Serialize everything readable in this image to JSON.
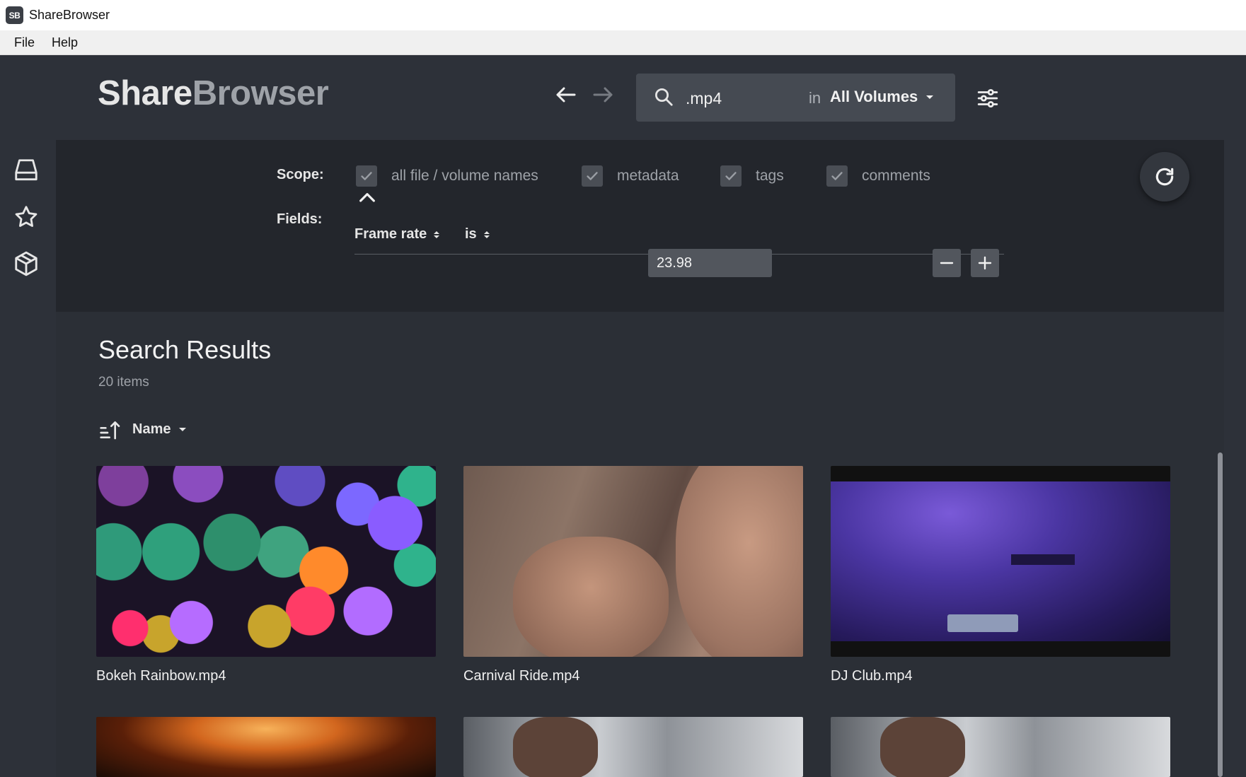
{
  "window": {
    "title": "ShareBrowser",
    "icon_text": "SB"
  },
  "menubar": {
    "items": [
      "File",
      "Help"
    ]
  },
  "header": {
    "logo_part1": "Share",
    "logo_part2": "Browser",
    "search_value": ".mp4",
    "in_label": "in",
    "volume": "All Volumes"
  },
  "sidebar": {
    "items": [
      "volumes-icon",
      "favorites-icon",
      "packages-icon"
    ]
  },
  "filter": {
    "scope_label": "Scope:",
    "scope_options": [
      {
        "label": "all file / volume names",
        "checked": true
      },
      {
        "label": "metadata",
        "checked": true
      },
      {
        "label": "tags",
        "checked": true
      },
      {
        "label": "comments",
        "checked": true
      }
    ],
    "fields_label": "Fields:",
    "field_name": "Frame rate",
    "operator": "is",
    "field_value": "23.98"
  },
  "results": {
    "title": "Search Results",
    "count": "20 items",
    "sort_by": "Name",
    "items": [
      {
        "name": "Bokeh Rainbow.mp4",
        "thumb": "bokeh"
      },
      {
        "name": "Carnival Ride.mp4",
        "thumb": "carnival"
      },
      {
        "name": "DJ Club.mp4",
        "thumb": "dj"
      },
      {
        "name": "",
        "thumb": "fire"
      },
      {
        "name": "",
        "thumb": "lab"
      },
      {
        "name": "",
        "thumb": "lab"
      }
    ]
  }
}
